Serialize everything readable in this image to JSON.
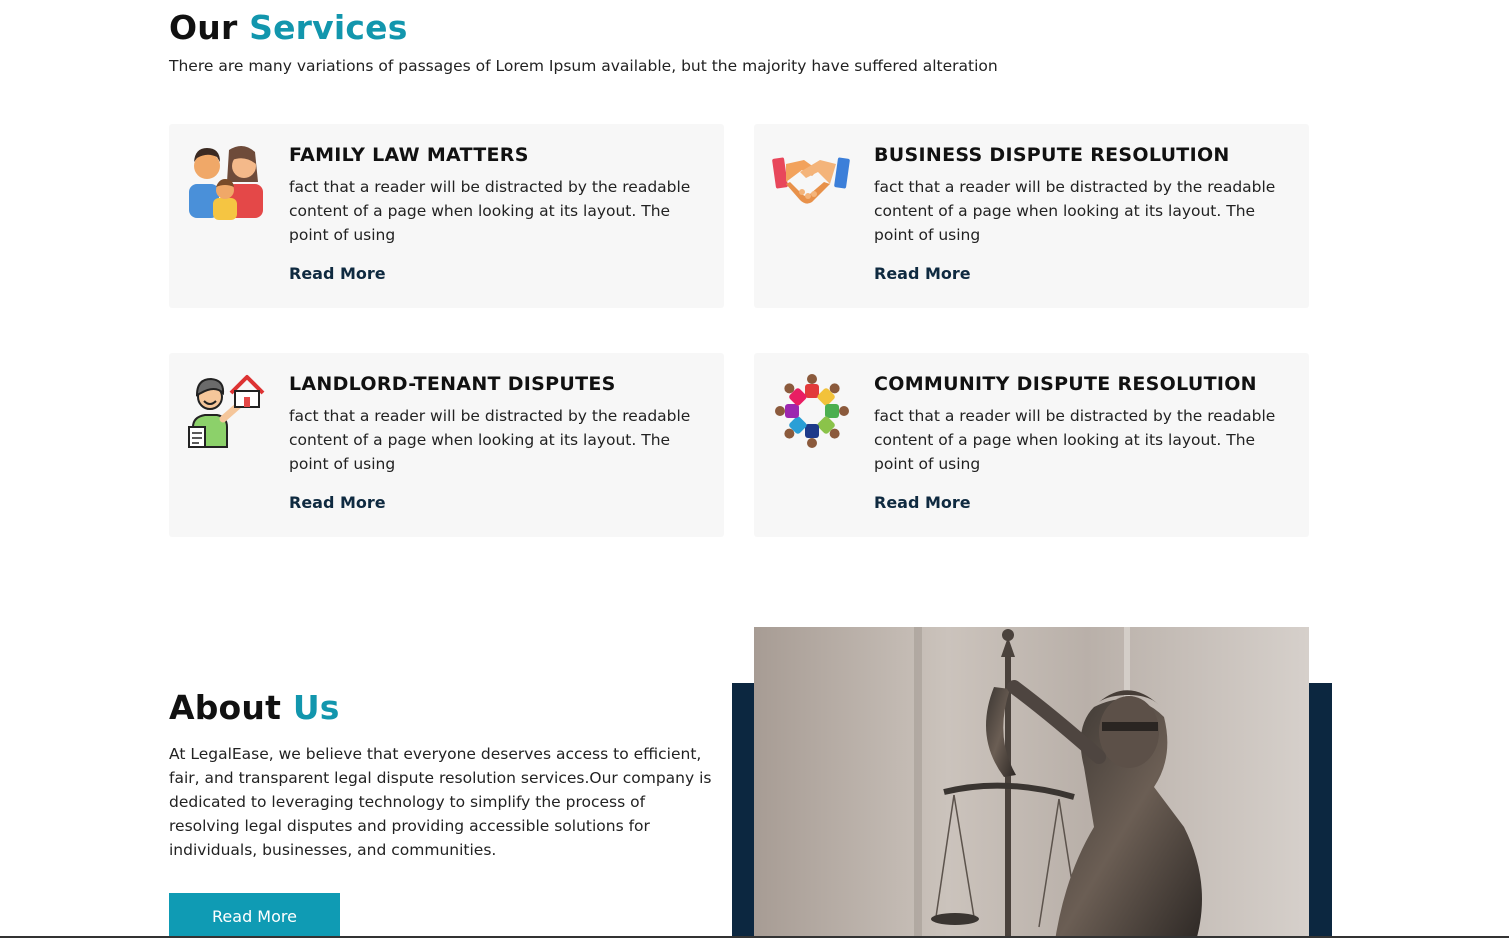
{
  "services": {
    "title_main": "Our",
    "title_accent": "Services",
    "subtitle": "There are many variations of passages of Lorem Ipsum available, but the majority have suffered alteration",
    "cards": [
      {
        "icon": "family-icon",
        "title": "FAMILY LAW MATTERS",
        "text": "fact that a reader will be distracted by the readable content of a page when looking at its layout. The point of using",
        "link": "Read More"
      },
      {
        "icon": "handshake-icon",
        "title": "BUSINESS DISPUTE RESOLUTION",
        "text": "fact that a reader will be distracted by the readable content of a page when looking at its layout. The point of using",
        "link": "Read More"
      },
      {
        "icon": "landlord-house-icon",
        "title": "LANDLORD-TENANT DISPUTES",
        "text": "fact that a reader will be distracted by the readable content of a page when looking at its layout. The point of using",
        "link": "Read More"
      },
      {
        "icon": "community-circle-icon",
        "title": "COMMUNITY DISPUTE RESOLUTION",
        "text": "fact that a reader will be distracted by the readable content of a page when looking at its layout. The point of using",
        "link": "Read More"
      }
    ]
  },
  "about": {
    "title_main": "About",
    "title_accent": "Us",
    "text": "At LegalEase, we believe that everyone deserves access to efficient, fair, and transparent legal dispute resolution services.Our company is dedicated to leveraging technology to simplify the process of resolving legal disputes and providing accessible solutions for individuals, businesses, and communities.",
    "button": "Read More",
    "image": "lady-justice-statue-image"
  },
  "colors": {
    "accent": "#1296ad",
    "button": "#0f9bb4",
    "navy": "#0c2740",
    "card_bg": "#f7f7f7"
  }
}
